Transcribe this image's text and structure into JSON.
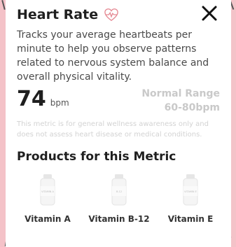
{
  "header": {
    "title": "Heart Rate"
  },
  "metric": {
    "description": "Tracks your average heartbeats per minute to help you observe patterns related to nervous system balance and overall physical vitality.",
    "value": "74",
    "unit": "bpm",
    "range_label": "Normal Range",
    "range_value": "60-80bpm",
    "disclaimer": "This metric is for general wellness awareness only and does not assess heart disease or medical conditions."
  },
  "products": {
    "title": "Products for this Metric",
    "items": [
      {
        "name": "Vitamin A",
        "label": "VITAMIN A"
      },
      {
        "name": "Vitamin B-12",
        "label": "B-12"
      },
      {
        "name": "Vitamin E",
        "label": "VITAMIN E"
      }
    ]
  },
  "colors": {
    "accent": "#e58a94",
    "background": "#f4c2c8"
  },
  "icons": {
    "title_icon": "heart-pulse-icon",
    "close": "close-icon"
  }
}
